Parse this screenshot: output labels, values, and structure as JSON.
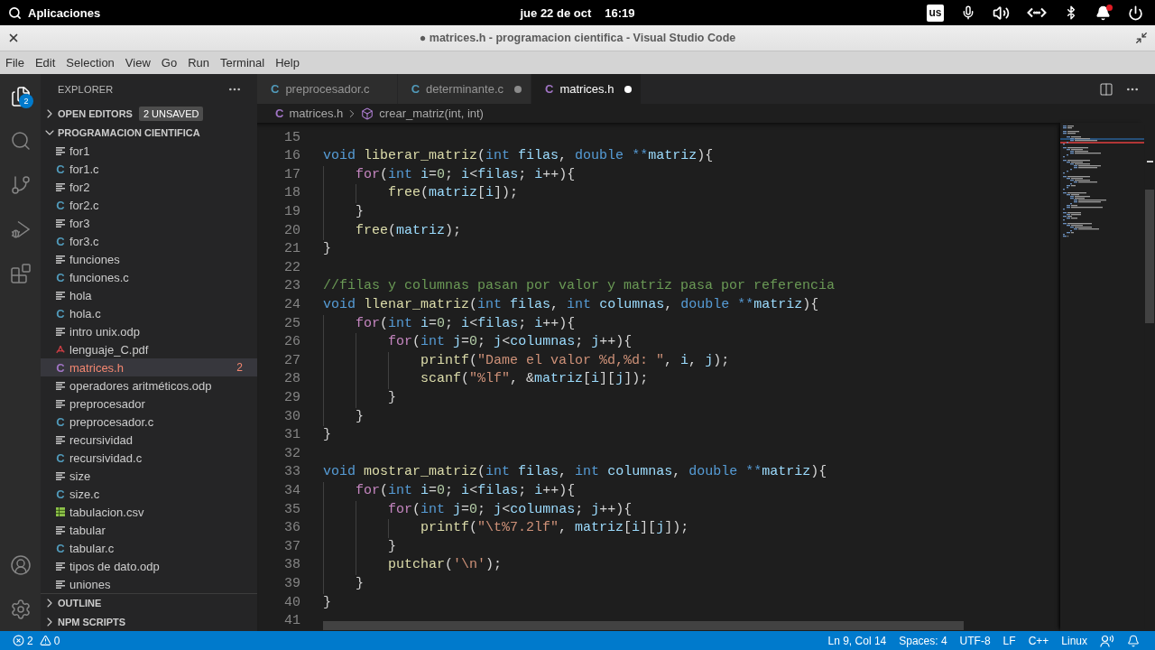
{
  "system_bar": {
    "apps_label": "Aplicaciones",
    "date": "jue 22 de oct",
    "time": "16:19",
    "keyboard_layout": "us",
    "notification_pending": true
  },
  "window": {
    "title": "● matrices.h - programacion cientifica - Visual Studio Code"
  },
  "menu": [
    "File",
    "Edit",
    "Selection",
    "View",
    "Go",
    "Run",
    "Terminal",
    "Help"
  ],
  "activity_bar": {
    "items": [
      {
        "kind": "explorer",
        "selected": true,
        "badge": "2"
      },
      {
        "kind": "search",
        "selected": false
      },
      {
        "kind": "source-control",
        "selected": false
      },
      {
        "kind": "run-debug",
        "selected": false
      },
      {
        "kind": "extensions",
        "selected": false
      }
    ],
    "bottom": [
      {
        "kind": "account"
      },
      {
        "kind": "manage"
      }
    ]
  },
  "sidebar": {
    "title": "EXPLORER",
    "open_editors": {
      "label": "OPEN EDITORS",
      "expanded": false,
      "badge": "2 UNSAVED"
    },
    "folder": {
      "label": "PROGRAMACION CIENTIFICA",
      "expanded": true
    },
    "files": [
      {
        "name": "for1",
        "kind": "text",
        "selected": false
      },
      {
        "name": "for1.c",
        "kind": "c",
        "glyph": "C",
        "selected": false
      },
      {
        "name": "for2",
        "kind": "text",
        "selected": false
      },
      {
        "name": "for2.c",
        "kind": "c",
        "glyph": "C",
        "selected": false
      },
      {
        "name": "for3",
        "kind": "text",
        "selected": false
      },
      {
        "name": "for3.c",
        "kind": "c",
        "glyph": "C",
        "selected": false
      },
      {
        "name": "funciones",
        "kind": "text",
        "selected": false
      },
      {
        "name": "funciones.c",
        "kind": "c",
        "glyph": "C",
        "selected": false
      },
      {
        "name": "hola",
        "kind": "text",
        "selected": false
      },
      {
        "name": "hola.c",
        "kind": "c",
        "glyph": "C",
        "selected": false
      },
      {
        "name": "intro unix.odp",
        "kind": "text",
        "selected": false
      },
      {
        "name": "lenguaje_C.pdf",
        "kind": "pdf",
        "selected": false
      },
      {
        "name": "matrices.h",
        "kind": "header",
        "glyph": "C",
        "selected": true,
        "problems": "2"
      },
      {
        "name": "operadores aritméticos.odp",
        "kind": "text",
        "selected": false
      },
      {
        "name": "preprocesador",
        "kind": "text",
        "selected": false
      },
      {
        "name": "preprocesador.c",
        "kind": "c",
        "glyph": "C",
        "selected": false
      },
      {
        "name": "recursividad",
        "kind": "text",
        "selected": false
      },
      {
        "name": "recursividad.c",
        "kind": "c",
        "glyph": "C",
        "selected": false
      },
      {
        "name": "size",
        "kind": "text",
        "selected": false
      },
      {
        "name": "size.c",
        "kind": "c",
        "glyph": "C",
        "selected": false
      },
      {
        "name": "tabulacion.csv",
        "kind": "csv",
        "selected": false
      },
      {
        "name": "tabular",
        "kind": "text",
        "selected": false
      },
      {
        "name": "tabular.c",
        "kind": "c",
        "glyph": "C",
        "selected": false
      },
      {
        "name": "tipos de dato.odp",
        "kind": "text",
        "selected": false
      },
      {
        "name": "uniones",
        "kind": "text",
        "selected": false
      }
    ],
    "sections": [
      {
        "label": "OUTLINE",
        "expanded": false
      },
      {
        "label": "NPM SCRIPTS",
        "expanded": false
      }
    ]
  },
  "tabs": [
    {
      "label": "preprocesador.c",
      "kind": "c",
      "glyph": "C",
      "selected": false,
      "modified": false
    },
    {
      "label": "determinante.c",
      "kind": "c",
      "glyph": "C",
      "selected": false,
      "modified": true
    },
    {
      "label": "matrices.h",
      "kind": "header",
      "glyph": "C",
      "selected": true,
      "modified": true
    }
  ],
  "breadcrumbs": [
    {
      "kind": "file",
      "glyph": "C",
      "label": "matrices.h"
    },
    {
      "kind": "function",
      "label": "crear_matriz(int, int)"
    }
  ],
  "editor": {
    "lines": [
      {
        "number": "15"
      },
      {
        "number": "16",
        "tokens": [
          {
            "kind": "type",
            "text": "void "
          },
          {
            "kind": "function",
            "text": "liberar_matriz"
          },
          {
            "kind": "plain",
            "text": "("
          },
          {
            "kind": "type",
            "text": "int "
          },
          {
            "kind": "variable",
            "text": "filas"
          },
          {
            "kind": "plain",
            "text": ", "
          },
          {
            "kind": "type",
            "text": "double "
          },
          {
            "kind": "pointer",
            "text": "**"
          },
          {
            "kind": "variable",
            "text": "matriz"
          },
          {
            "kind": "plain",
            "text": "){"
          }
        ],
        "children": [
          {
            "number": "17",
            "tokens": [
              {
                "kind": "control",
                "text": "for"
              },
              {
                "kind": "plain",
                "text": "("
              },
              {
                "kind": "type",
                "text": "int "
              },
              {
                "kind": "variable",
                "text": "i"
              },
              {
                "kind": "plain",
                "text": "="
              },
              {
                "kind": "number",
                "text": "0"
              },
              {
                "kind": "plain",
                "text": "; "
              },
              {
                "kind": "variable",
                "text": "i"
              },
              {
                "kind": "plain",
                "text": "<"
              },
              {
                "kind": "variable",
                "text": "filas"
              },
              {
                "kind": "plain",
                "text": "; "
              },
              {
                "kind": "variable",
                "text": "i"
              },
              {
                "kind": "plain",
                "text": "++){"
              }
            ],
            "children": [
              {
                "number": "18",
                "tokens": [
                  {
                    "kind": "function",
                    "text": "free"
                  },
                  {
                    "kind": "plain",
                    "text": "("
                  },
                  {
                    "kind": "variable",
                    "text": "matriz"
                  },
                  {
                    "kind": "plain",
                    "text": "["
                  },
                  {
                    "kind": "variable",
                    "text": "i"
                  },
                  {
                    "kind": "plain",
                    "text": "]);"
                  }
                ]
              }
            ]
          },
          {
            "number": "19",
            "tokens": [
              {
                "kind": "plain",
                "text": "}"
              }
            ]
          },
          {
            "number": "20",
            "tokens": [
              {
                "kind": "function",
                "text": "free"
              },
              {
                "kind": "plain",
                "text": "("
              },
              {
                "kind": "variable",
                "text": "matriz"
              },
              {
                "kind": "plain",
                "text": ");"
              }
            ]
          }
        ]
      },
      {
        "number": "21",
        "tokens": [
          {
            "kind": "plain",
            "text": "}"
          }
        ]
      },
      {
        "number": "22"
      },
      {
        "number": "23",
        "tokens": [
          {
            "kind": "comment",
            "text": "//filas y columnas pasan por valor y matriz pasa por referencia"
          }
        ]
      },
      {
        "number": "24",
        "tokens": [
          {
            "kind": "type",
            "text": "void "
          },
          {
            "kind": "function",
            "text": "llenar_matriz"
          },
          {
            "kind": "plain",
            "text": "("
          },
          {
            "kind": "type",
            "text": "int "
          },
          {
            "kind": "variable",
            "text": "filas"
          },
          {
            "kind": "plain",
            "text": ", "
          },
          {
            "kind": "type",
            "text": "int "
          },
          {
            "kind": "variable",
            "text": "columnas"
          },
          {
            "kind": "plain",
            "text": ", "
          },
          {
            "kind": "type",
            "text": "double "
          },
          {
            "kind": "pointer",
            "text": "**"
          },
          {
            "kind": "variable",
            "text": "matriz"
          },
          {
            "kind": "plain",
            "text": "){"
          }
        ],
        "children": [
          {
            "number": "25",
            "tokens": [
              {
                "kind": "control",
                "text": "for"
              },
              {
                "kind": "plain",
                "text": "("
              },
              {
                "kind": "type",
                "text": "int "
              },
              {
                "kind": "variable",
                "text": "i"
              },
              {
                "kind": "plain",
                "text": "="
              },
              {
                "kind": "number",
                "text": "0"
              },
              {
                "kind": "plain",
                "text": "; "
              },
              {
                "kind": "variable",
                "text": "i"
              },
              {
                "kind": "plain",
                "text": "<"
              },
              {
                "kind": "variable",
                "text": "filas"
              },
              {
                "kind": "plain",
                "text": "; "
              },
              {
                "kind": "variable",
                "text": "i"
              },
              {
                "kind": "plain",
                "text": "++){"
              }
            ],
            "children": [
              {
                "number": "26",
                "tokens": [
                  {
                    "kind": "control",
                    "text": "for"
                  },
                  {
                    "kind": "plain",
                    "text": "("
                  },
                  {
                    "kind": "type",
                    "text": "int "
                  },
                  {
                    "kind": "variable",
                    "text": "j"
                  },
                  {
                    "kind": "plain",
                    "text": "="
                  },
                  {
                    "kind": "number",
                    "text": "0"
                  },
                  {
                    "kind": "plain",
                    "text": "; "
                  },
                  {
                    "kind": "variable",
                    "text": "j"
                  },
                  {
                    "kind": "plain",
                    "text": "<"
                  },
                  {
                    "kind": "variable",
                    "text": "columnas"
                  },
                  {
                    "kind": "plain",
                    "text": "; "
                  },
                  {
                    "kind": "variable",
                    "text": "j"
                  },
                  {
                    "kind": "plain",
                    "text": "++){"
                  }
                ],
                "children": [
                  {
                    "number": "27",
                    "tokens": [
                      {
                        "kind": "function",
                        "text": "printf"
                      },
                      {
                        "kind": "plain",
                        "text": "("
                      },
                      {
                        "kind": "string",
                        "text": "\"Dame el valor %d,%d: \""
                      },
                      {
                        "kind": "plain",
                        "text": ", "
                      },
                      {
                        "kind": "variable",
                        "text": "i"
                      },
                      {
                        "kind": "plain",
                        "text": ", "
                      },
                      {
                        "kind": "variable",
                        "text": "j"
                      },
                      {
                        "kind": "plain",
                        "text": ");"
                      }
                    ]
                  },
                  {
                    "number": "28",
                    "tokens": [
                      {
                        "kind": "function",
                        "text": "scanf"
                      },
                      {
                        "kind": "plain",
                        "text": "("
                      },
                      {
                        "kind": "string",
                        "text": "\"%lf\""
                      },
                      {
                        "kind": "plain",
                        "text": ", &"
                      },
                      {
                        "kind": "variable",
                        "text": "matriz"
                      },
                      {
                        "kind": "plain",
                        "text": "["
                      },
                      {
                        "kind": "variable",
                        "text": "i"
                      },
                      {
                        "kind": "plain",
                        "text": "]["
                      },
                      {
                        "kind": "variable",
                        "text": "j"
                      },
                      {
                        "kind": "plain",
                        "text": "]);"
                      }
                    ]
                  }
                ]
              },
              {
                "number": "29",
                "tokens": [
                  {
                    "kind": "plain",
                    "text": "}"
                  }
                ]
              }
            ]
          },
          {
            "number": "30",
            "tokens": [
              {
                "kind": "plain",
                "text": "}"
              }
            ]
          }
        ]
      },
      {
        "number": "31",
        "tokens": [
          {
            "kind": "plain",
            "text": "}"
          }
        ]
      },
      {
        "number": "32"
      },
      {
        "number": "33",
        "tokens": [
          {
            "kind": "type",
            "text": "void "
          },
          {
            "kind": "function",
            "text": "mostrar_matriz"
          },
          {
            "kind": "plain",
            "text": "("
          },
          {
            "kind": "type",
            "text": "int "
          },
          {
            "kind": "variable",
            "text": "filas"
          },
          {
            "kind": "plain",
            "text": ", "
          },
          {
            "kind": "type",
            "text": "int "
          },
          {
            "kind": "variable",
            "text": "columnas"
          },
          {
            "kind": "plain",
            "text": ", "
          },
          {
            "kind": "type",
            "text": "double "
          },
          {
            "kind": "pointer",
            "text": "**"
          },
          {
            "kind": "variable",
            "text": "matriz"
          },
          {
            "kind": "plain",
            "text": "){"
          }
        ],
        "children": [
          {
            "number": "34",
            "tokens": [
              {
                "kind": "control",
                "text": "for"
              },
              {
                "kind": "plain",
                "text": "("
              },
              {
                "kind": "type",
                "text": "int "
              },
              {
                "kind": "variable",
                "text": "i"
              },
              {
                "kind": "plain",
                "text": "="
              },
              {
                "kind": "number",
                "text": "0"
              },
              {
                "kind": "plain",
                "text": "; "
              },
              {
                "kind": "variable",
                "text": "i"
              },
              {
                "kind": "plain",
                "text": "<"
              },
              {
                "kind": "variable",
                "text": "filas"
              },
              {
                "kind": "plain",
                "text": "; "
              },
              {
                "kind": "variable",
                "text": "i"
              },
              {
                "kind": "plain",
                "text": "++){"
              }
            ],
            "children": [
              {
                "number": "35",
                "tokens": [
                  {
                    "kind": "control",
                    "text": "for"
                  },
                  {
                    "kind": "plain",
                    "text": "("
                  },
                  {
                    "kind": "type",
                    "text": "int "
                  },
                  {
                    "kind": "variable",
                    "text": "j"
                  },
                  {
                    "kind": "plain",
                    "text": "="
                  },
                  {
                    "kind": "number",
                    "text": "0"
                  },
                  {
                    "kind": "plain",
                    "text": "; "
                  },
                  {
                    "kind": "variable",
                    "text": "j"
                  },
                  {
                    "kind": "plain",
                    "text": "<"
                  },
                  {
                    "kind": "variable",
                    "text": "columnas"
                  },
                  {
                    "kind": "plain",
                    "text": "; "
                  },
                  {
                    "kind": "variable",
                    "text": "j"
                  },
                  {
                    "kind": "plain",
                    "text": "++){"
                  }
                ],
                "children": [
                  {
                    "number": "36",
                    "tokens": [
                      {
                        "kind": "function",
                        "text": "printf"
                      },
                      {
                        "kind": "plain",
                        "text": "("
                      },
                      {
                        "kind": "string",
                        "text": "\"\\t%7.2lf\""
                      },
                      {
                        "kind": "plain",
                        "text": ", "
                      },
                      {
                        "kind": "variable",
                        "text": "matriz"
                      },
                      {
                        "kind": "plain",
                        "text": "["
                      },
                      {
                        "kind": "variable",
                        "text": "i"
                      },
                      {
                        "kind": "plain",
                        "text": "]["
                      },
                      {
                        "kind": "variable",
                        "text": "j"
                      },
                      {
                        "kind": "plain",
                        "text": "]);"
                      }
                    ]
                  }
                ]
              },
              {
                "number": "37",
                "tokens": [
                  {
                    "kind": "plain",
                    "text": "}"
                  }
                ]
              },
              {
                "number": "38",
                "tokens": [
                  {
                    "kind": "function",
                    "text": "putchar"
                  },
                  {
                    "kind": "plain",
                    "text": "("
                  },
                  {
                    "kind": "string",
                    "text": "'\\n'"
                  },
                  {
                    "kind": "plain",
                    "text": ");"
                  }
                ]
              }
            ]
          },
          {
            "number": "39",
            "tokens": [
              {
                "kind": "plain",
                "text": "}"
              }
            ]
          }
        ]
      },
      {
        "number": "40",
        "tokens": [
          {
            "kind": "plain",
            "text": "}"
          }
        ]
      },
      {
        "number": "41"
      }
    ]
  },
  "status_bar": {
    "errors": "2",
    "warnings": "0",
    "items": [
      "Ln 9, Col 14",
      "Spaces: 4",
      "UTF-8",
      "LF",
      "C++",
      "Linux"
    ]
  }
}
